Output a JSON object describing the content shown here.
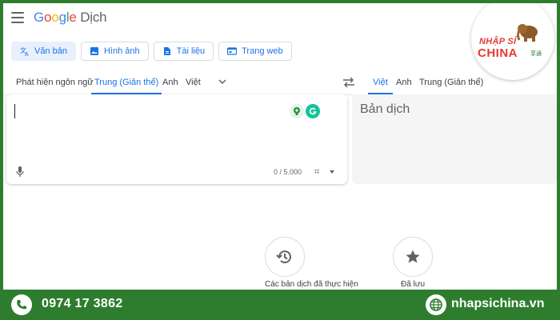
{
  "app": {
    "logo_word": "Google",
    "logo_product": "Dịch"
  },
  "modes": [
    {
      "label": "Văn bản",
      "icon": "translate-icon",
      "active": true
    },
    {
      "label": "Hình ảnh",
      "icon": "image-icon",
      "active": false
    },
    {
      "label": "Tài liệu",
      "icon": "document-icon",
      "active": false
    },
    {
      "label": "Trang web",
      "icon": "web-icon",
      "active": false
    }
  ],
  "source_langs": [
    {
      "label": "Phát hiện ngôn ngữ",
      "active": false
    },
    {
      "label": "Trung (Giản thể)",
      "active": true
    },
    {
      "label": "Anh",
      "active": false
    },
    {
      "label": "Việt",
      "active": false
    }
  ],
  "target_langs": [
    {
      "label": "Việt",
      "active": true
    },
    {
      "label": "Anh",
      "active": false
    },
    {
      "label": "Trung (Giản thể)",
      "active": false
    }
  ],
  "source": {
    "value": "",
    "char_count": "0 / 5.000"
  },
  "target": {
    "placeholder": "Bản dịch"
  },
  "bottom_actions": [
    {
      "label": "Các bản dịch đã thực hiện",
      "icon": "history-icon"
    },
    {
      "label": "Đã lưu",
      "icon": "star-icon"
    }
  ],
  "brand": {
    "line1": "NHẬP SỈ",
    "line2": "CHINA",
    "cn": "享通",
    "accent": "#e53935"
  },
  "footer": {
    "phone": "0974 17 3862",
    "website": "nhapsichina.vn",
    "bg": "#2e7d2e"
  }
}
